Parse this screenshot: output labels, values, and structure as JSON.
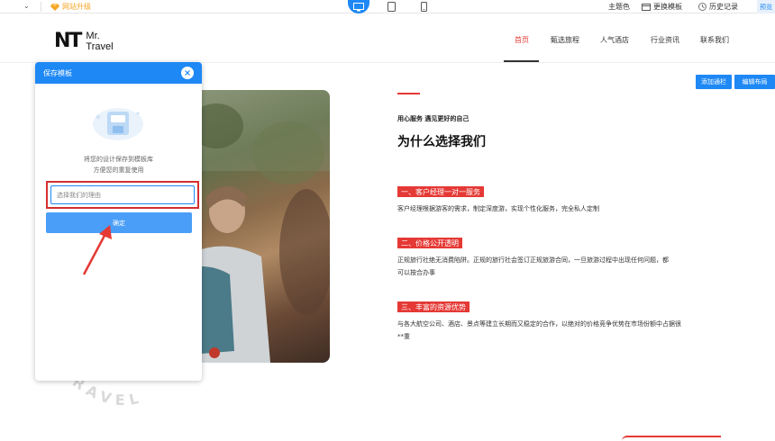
{
  "topbar": {
    "upgrade_label": "网站升级",
    "theme_label": "主题色",
    "change_template_label": "更换模板",
    "history_label": "历史记录",
    "preview_label": "预览"
  },
  "site": {
    "logo_mark": "NT",
    "logo_line1": "Mr.",
    "logo_line2": "Travel",
    "menu": [
      "首页",
      "甄选旅程",
      "人气酒店",
      "行业资讯",
      "联系我们"
    ]
  },
  "actions": {
    "add_section": "添加通栏",
    "edit_layout": "编辑布局"
  },
  "content": {
    "tagline": "用心服务 遇见更好的自己",
    "heading": "为什么选择我们",
    "items": [
      {
        "badge": "一、客户经理一对一服务",
        "text": "客户经理根据游客的需求，制定深度游，实现个性化服务，完全私人定制"
      },
      {
        "badge": "二、价格公开透明",
        "text": "正规旅行社绝无消费陷阱。正规的旅行社会签订正规旅游合同，一旦旅游过程中出现任何问题，都可以按合办事"
      },
      {
        "badge": "三、丰富的资源优势",
        "text": "与各大航空公司、酒店、景点等建立长期而又稳定的合作，以绝对的价格竞争优势在市场份额中占据很**重"
      }
    ],
    "watermark": "TRAVEL"
  },
  "modal": {
    "title": "保存模板",
    "desc_line1": "将您的设计保存到模板库",
    "desc_line2": "方便您的重复使用",
    "input_placeholder": "选择我们的理由",
    "confirm_label": "确定"
  },
  "colors": {
    "primary": "#1e88f5",
    "accent_red": "#e53935",
    "highlight_border": "#d32f2f"
  }
}
